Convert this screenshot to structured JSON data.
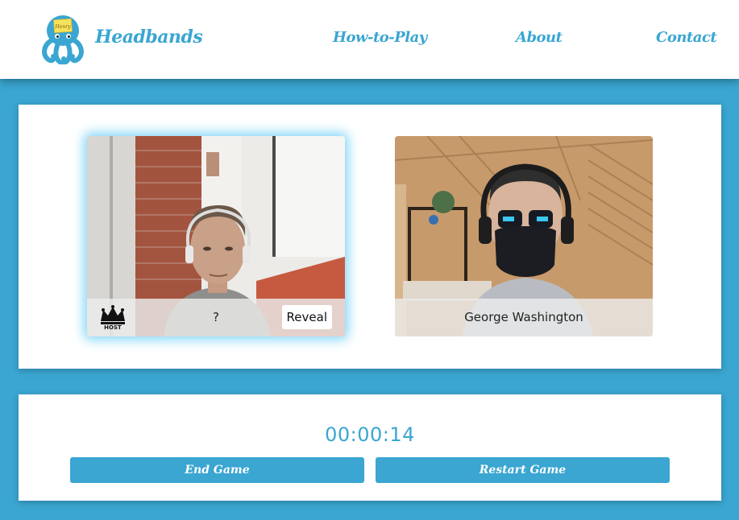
{
  "header": {
    "brand": "Headbands",
    "logo_sticky_note": "Henry",
    "nav": {
      "how_to_play": "How-to-Play",
      "about": "About",
      "contact": "Contact"
    }
  },
  "players": [
    {
      "name": "?",
      "is_host": true,
      "host_badge": "HOST",
      "reveal_label": "Reveal",
      "active": true
    },
    {
      "name": "George Washington",
      "is_host": false,
      "active": false
    }
  ],
  "game": {
    "timer": "00:00:14",
    "end_label": "End Game",
    "restart_label": "Restart Game"
  },
  "colors": {
    "accent": "#3aa6d1",
    "background": "#3aa6d1",
    "panel": "#ffffff"
  },
  "icons": [
    "octopus-logo-icon",
    "crown-icon"
  ]
}
